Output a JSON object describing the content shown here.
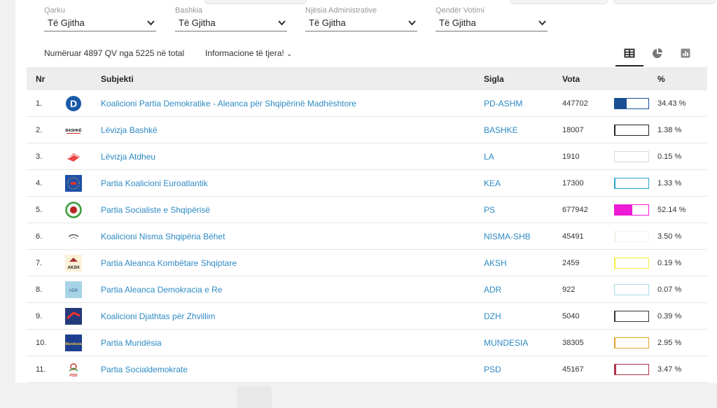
{
  "filters": [
    {
      "label": "Qarku",
      "value": "Të Gjitha"
    },
    {
      "label": "Bashkia",
      "value": "Të Gjitha"
    },
    {
      "label": "Njësia Administrative",
      "value": "Të Gjitha"
    },
    {
      "label": "Qendër Votimi",
      "value": "Të Gjitha"
    }
  ],
  "summary": "Numëruar 4897 QV nga 5225 në total",
  "more_info": "Informacione të tjera!",
  "view_icons": [
    "table-icon",
    "pie-chart-icon",
    "bar-chart-icon"
  ],
  "table": {
    "headers": {
      "nr": "Nr",
      "subject": "Subjekti",
      "sigla": "Sigla",
      "votes": "Vota",
      "percent": "%"
    },
    "rows": [
      {
        "nr": "1.",
        "name": "Koalicioni Partia Demokratike - Aleanca për Shqipërinë Madhështore",
        "sigla": "PD-ASHM",
        "votes": "447702",
        "percent": "34.43 %",
        "share": 34.43,
        "bar_color": "#1b4f93",
        "logo": "pd-logo-icon"
      },
      {
        "nr": "2.",
        "name": "Lëvizja Bashkë",
        "sigla": "BASHKE",
        "votes": "18007",
        "percent": "1.38 %",
        "share": 1.38,
        "bar_color": "#222222",
        "logo": "bashke-logo-icon",
        "logo_text": "BASHKË"
      },
      {
        "nr": "3.",
        "name": "Lëvizja Atdheu",
        "sigla": "LA",
        "votes": "1910",
        "percent": "0.15 %",
        "share": 0.15,
        "bar_color": "#d8d8d8",
        "logo": "la-logo-icon"
      },
      {
        "nr": "4.",
        "name": "Partia Koalicioni Euroatlantik",
        "sigla": "KEA",
        "votes": "17300",
        "percent": "1.33 %",
        "share": 1.33,
        "bar_color": "#2aa6c9",
        "logo": "kea-logo-icon"
      },
      {
        "nr": "5.",
        "name": "Partia Socialiste e Shqipërisë",
        "sigla": "PS",
        "votes": "677942",
        "percent": "52.14 %",
        "share": 52.14,
        "bar_color": "#ee1ad6",
        "logo": "ps-logo-icon"
      },
      {
        "nr": "6.",
        "name": "Koalicioni Nisma Shqipëria Bëhet",
        "sigla": "NISMA-SHB",
        "votes": "45491",
        "percent": "3.50 %",
        "share": 3.5,
        "bar_color": "#f3f3ec",
        "logo": "nisma-logo-icon"
      },
      {
        "nr": "7.",
        "name": "Partia Aleanca Kombëtare Shqiptare",
        "sigla": "AKSH",
        "votes": "2459",
        "percent": "0.19 %",
        "share": 0.19,
        "bar_color": "#f0ef3c",
        "logo": "aksh-logo-icon",
        "logo_text": "AKSH"
      },
      {
        "nr": "8.",
        "name": "Partia Aleanca Demokracia e Re",
        "sigla": "ADR",
        "votes": "922",
        "percent": "0.07 %",
        "share": 0.07,
        "bar_color": "#a9dbe8",
        "logo": "adr-logo-icon",
        "logo_text": "ADR"
      },
      {
        "nr": "9.",
        "name": "Koalicioni Djathtas për Zhvillim",
        "sigla": "DZH",
        "votes": "5040",
        "percent": "0.39 %",
        "share": 0.39,
        "bar_color": "#333333",
        "logo": "dzh-logo-icon"
      },
      {
        "nr": "10.",
        "name": "Partia Mundësia",
        "sigla": "MUNDESIA",
        "votes": "38305",
        "percent": "2.95 %",
        "share": 2.95,
        "bar_color": "#e3a32c",
        "logo": "mundesia-logo-icon",
        "logo_text": "Mundesia"
      },
      {
        "nr": "11.",
        "name": "Partia Socialdemokrate",
        "sigla": "PSD",
        "votes": "45167",
        "percent": "3.47 %",
        "share": 3.47,
        "bar_color": "#b0304a",
        "logo": "psd-logo-icon",
        "logo_text": "PSD"
      }
    ]
  }
}
